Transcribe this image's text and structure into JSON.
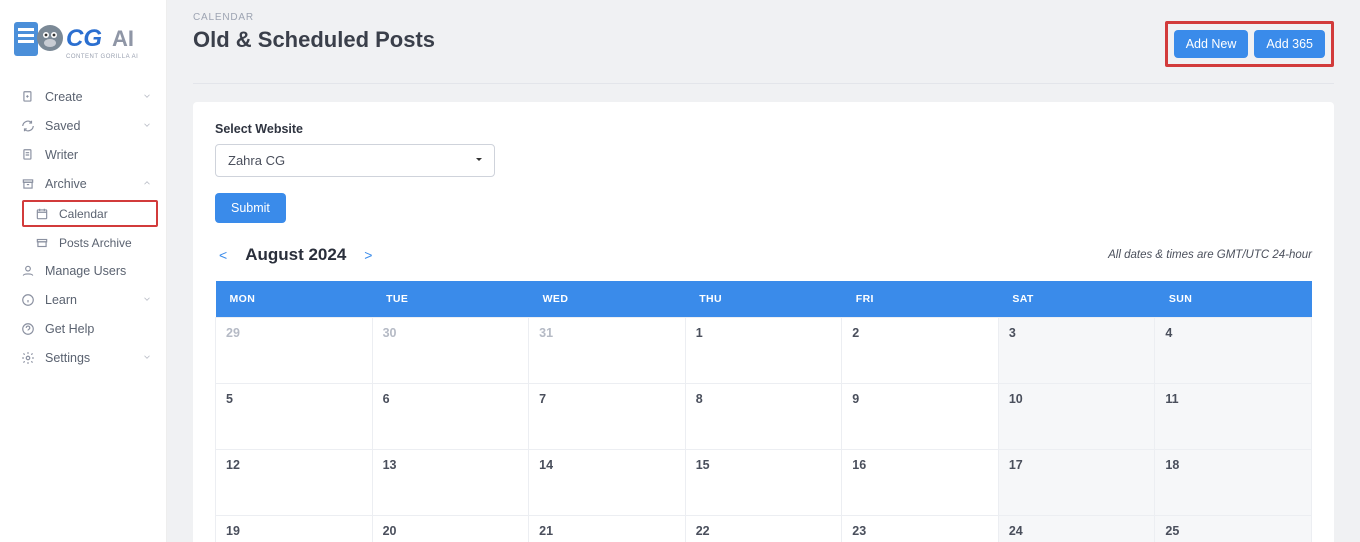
{
  "brand": {
    "name": "CG AI",
    "tagline": "CONTENT GORILLA AI"
  },
  "sidebar": {
    "create": "Create",
    "saved": "Saved",
    "writer": "Writer",
    "archive": "Archive",
    "calendar": "Calendar",
    "posts_archive": "Posts Archive",
    "manage_users": "Manage Users",
    "learn": "Learn",
    "get_help": "Get Help",
    "settings": "Settings"
  },
  "breadcrumb": "CALENDAR",
  "page_title": "Old & Scheduled Posts",
  "buttons": {
    "add_new": "Add New",
    "add_365": "Add 365",
    "submit": "Submit"
  },
  "select_website_label": "Select Website",
  "select_website_value": "Zahra CG",
  "month_label": "August 2024",
  "tz_note": "All dates & times are GMT/UTC 24-hour",
  "weekdays": [
    "MON",
    "TUE",
    "WED",
    "THU",
    "FRI",
    "SAT",
    "SUN"
  ],
  "weeks": [
    [
      {
        "n": "29",
        "other": true
      },
      {
        "n": "30",
        "other": true
      },
      {
        "n": "31",
        "other": true
      },
      {
        "n": "1"
      },
      {
        "n": "2"
      },
      {
        "n": "3",
        "wknd": true
      },
      {
        "n": "4",
        "wknd": true
      }
    ],
    [
      {
        "n": "5"
      },
      {
        "n": "6"
      },
      {
        "n": "7"
      },
      {
        "n": "8"
      },
      {
        "n": "9"
      },
      {
        "n": "10",
        "wknd": true
      },
      {
        "n": "11",
        "wknd": true
      }
    ],
    [
      {
        "n": "12"
      },
      {
        "n": "13"
      },
      {
        "n": "14"
      },
      {
        "n": "15"
      },
      {
        "n": "16"
      },
      {
        "n": "17",
        "wknd": true
      },
      {
        "n": "18",
        "wknd": true
      }
    ],
    [
      {
        "n": "19"
      },
      {
        "n": "20"
      },
      {
        "n": "21"
      },
      {
        "n": "22"
      },
      {
        "n": "23"
      },
      {
        "n": "24",
        "wknd": true
      },
      {
        "n": "25",
        "wknd": true
      }
    ]
  ]
}
